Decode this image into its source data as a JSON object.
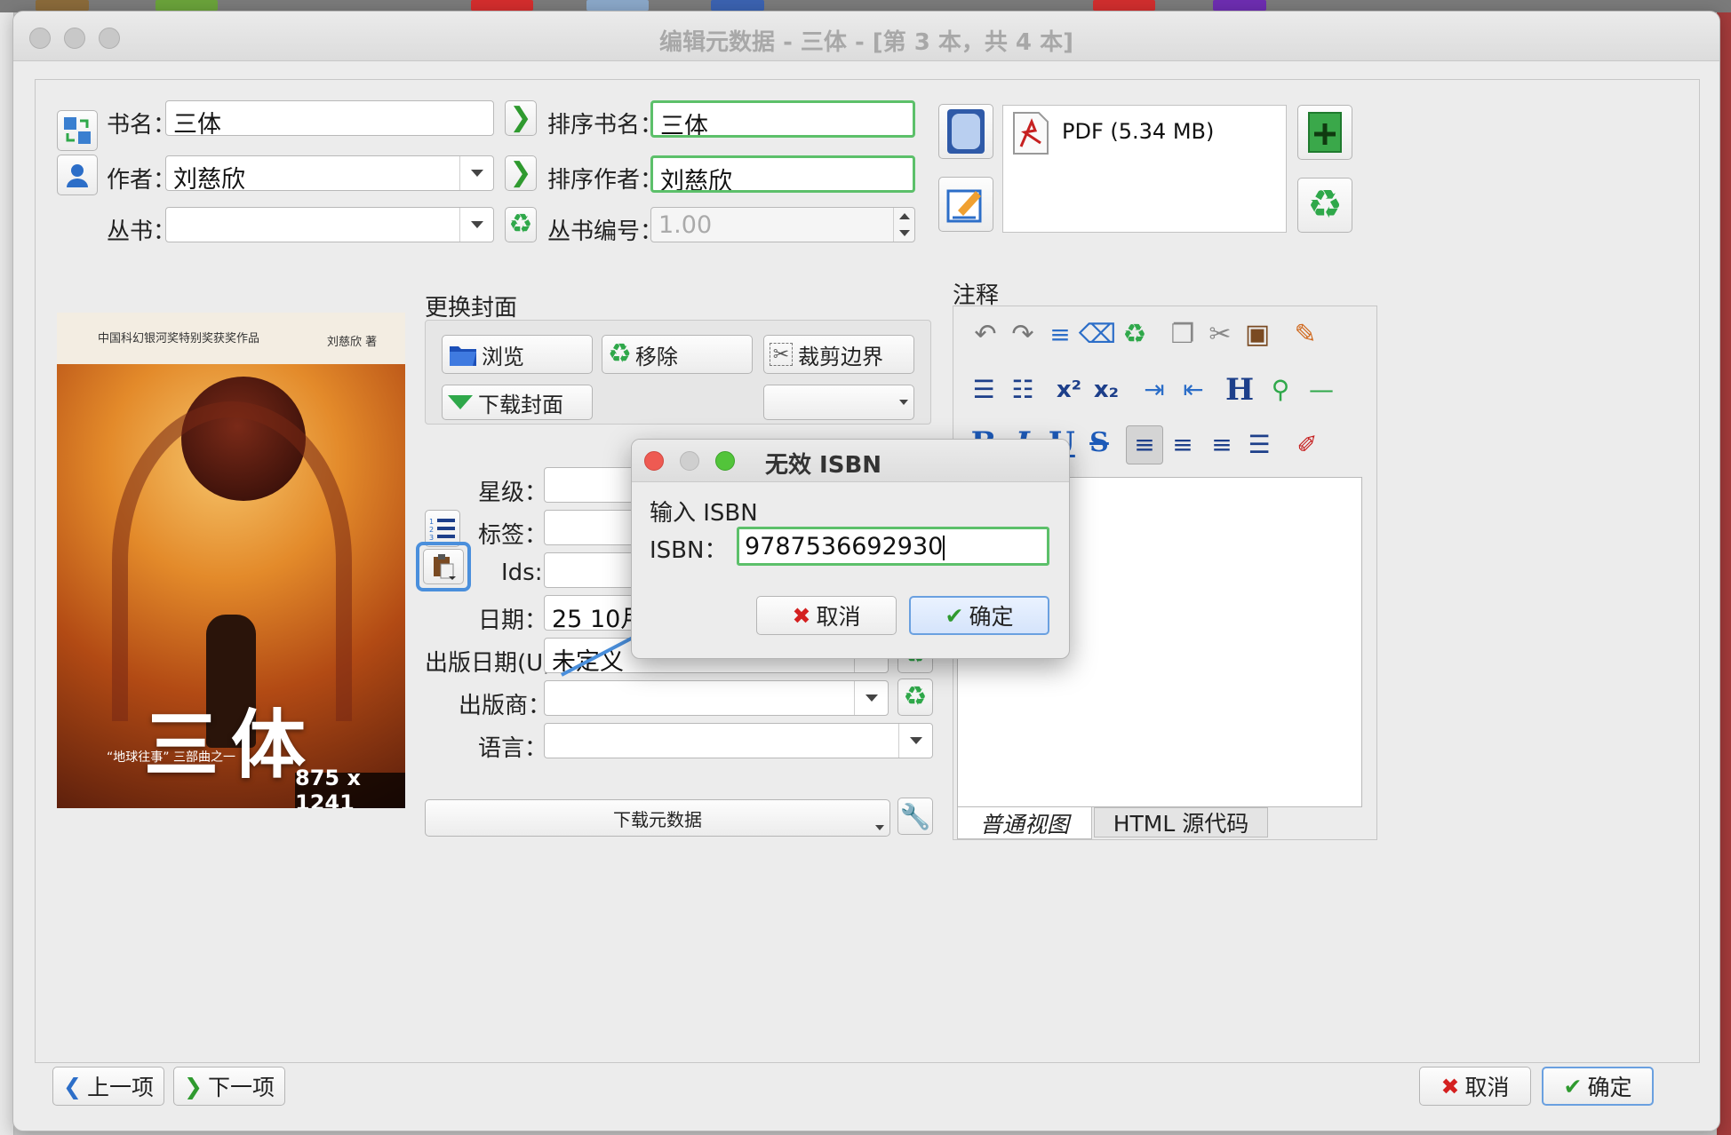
{
  "window": {
    "title": "编辑元数据 - 三体 - [第 3 本，共 4 本]"
  },
  "fields": {
    "title_label": "书名：",
    "title_value": "三体",
    "sort_title_label": "排序书名：",
    "sort_title_value": "三体",
    "author_label": "作者：",
    "author_value": "刘慈欣",
    "sort_author_label": "排序作者：",
    "sort_author_value": "刘慈欣",
    "series_label": "丛书：",
    "series_value": "",
    "series_index_label": "丛书编号：",
    "series_index_value": "1.00"
  },
  "format": {
    "item": "PDF (5.34 MB)"
  },
  "cover": {
    "group_label": "更换封面",
    "browse_label": "浏览",
    "remove_label": "移除",
    "trim_label": "裁剪边界",
    "download_label": "下载封面",
    "size_label": "875 x 1241",
    "art_top_left": "中国科幻银河奖特别奖获奖作品",
    "art_top_right": "刘慈欣 著",
    "art_title": "三体",
    "art_subtitle": "“地球往事” 三部曲之一"
  },
  "meta": {
    "rating_label": "星级：",
    "tags_label": "标签：",
    "ids_label": "Ids:",
    "ids_value": "",
    "date_label": "日期：",
    "date_value": "25 10月 2021",
    "pubdate_label": "出版日期(U):",
    "pubdate_value": "未定义",
    "publisher_label": "出版商：",
    "publisher_value": "",
    "language_label": "语言：",
    "language_value": "",
    "download_metadata_label": "下载元数据"
  },
  "comments": {
    "label": "注释",
    "tab_normal": "普通视图",
    "tab_html": "HTML 源代码"
  },
  "dialog": {
    "title": "无效 ISBN",
    "prompt": "输入 ISBN",
    "isbn_label": "ISBN：",
    "isbn_value": "9787536692930",
    "cancel_label": "取消",
    "ok_label": "确定"
  },
  "footer": {
    "prev_label": "上一项",
    "next_label": "下一项",
    "cancel_label": "取消",
    "ok_label": "确定"
  },
  "icons": [
    "swap-icon",
    "person-icon",
    "arrow-right-icon",
    "recycle-icon",
    "cover-icon",
    "edit-icon",
    "pdf-icon",
    "add-format-icon",
    "folder-icon",
    "trash-icon",
    "crop-icon",
    "download-icon",
    "tag-list-icon",
    "paste-icon",
    "wrench-icon",
    "undo-icon",
    "redo-icon",
    "bold-icon",
    "italic-icon",
    "underline-icon",
    "strike-icon"
  ],
  "colors": {
    "accent_green": "#5cc06a",
    "focus_blue": "#4a8fdc",
    "recycle_green": "#2fa84a",
    "cancel_red": "#d42020"
  }
}
